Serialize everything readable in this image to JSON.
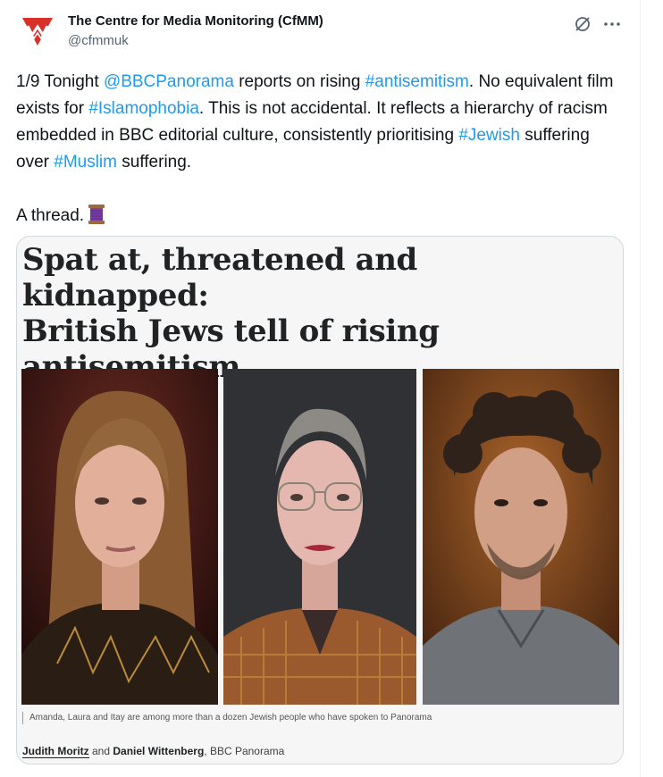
{
  "tweet": {
    "display_name": "The Centre for Media Monitoring (CfMM)",
    "handle": "@cfmmuk",
    "text": {
      "t1": "1/9 Tonight ",
      "l1": "@BBCPanorama",
      "t2": " reports on rising ",
      "l2": "#antisemitism",
      "t3": ". No equivalent film exists for ",
      "l3": "#Islamophobia",
      "t4": ". This is not accidental. It reflects a hierarchy of racism embedded in BBC editorial culture, consistently prioritising ",
      "l4": "#Jewish",
      "t5": " suffering over ",
      "l5": "#Muslim",
      "t6": " suffering.",
      "t7": "A thread."
    },
    "link_color": "#1d9bf0"
  },
  "card": {
    "headline_line1": "Spat at, threatened and kidnapped:",
    "headline_line2": "British Jews tell of rising",
    "headline_line3": "antisemitism",
    "caption": "Amanda, Laura and Itay are among more than a dozen Jewish people who have spoken to Panorama",
    "byline": {
      "author1": "Judith Moritz",
      "and": "and",
      "author2": "Daniel Wittenberg",
      "outlet": ", BBC Panorama"
    }
  },
  "icons": {
    "avatar": "cfmm-logo-icon",
    "grok": "grok-icon",
    "more": "more-icon",
    "thread": "thread-spool-icon"
  },
  "colors": {
    "brand_red": "#d9302a",
    "text": "#0f1419",
    "muted": "#536471"
  }
}
